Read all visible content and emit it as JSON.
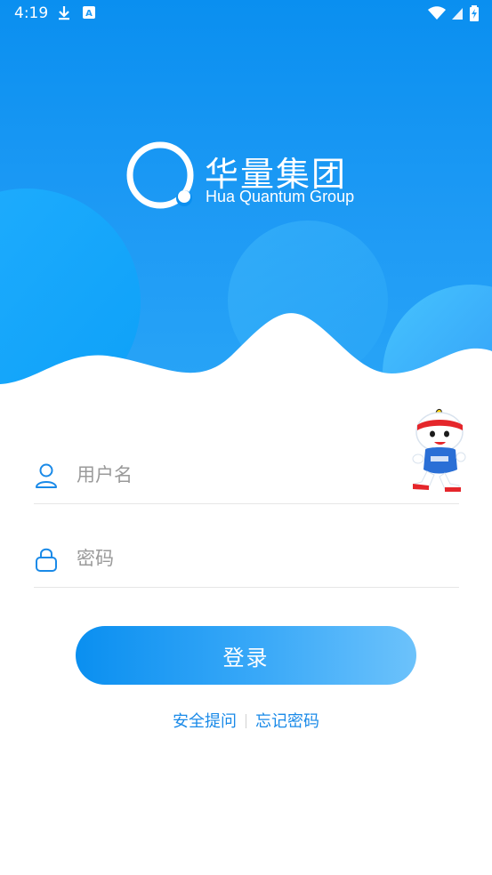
{
  "status_bar": {
    "time": "4:19",
    "left_icons": [
      "download-icon",
      "a-badge-icon"
    ],
    "right_icons": [
      "wifi-icon",
      "signal-icon",
      "battery-icon"
    ]
  },
  "brand": {
    "name_cn": "华量集团",
    "name_en": "Hua Quantum Group"
  },
  "form": {
    "username_placeholder": "用户名",
    "password_placeholder": "密码",
    "login_label": "登录"
  },
  "links": {
    "security_tips": "安全提问",
    "forgot_password": "忘记密码"
  },
  "colors": {
    "primary": "#0a8ff0",
    "link": "#1a8ae8",
    "placeholder": "#9a9a9a"
  }
}
